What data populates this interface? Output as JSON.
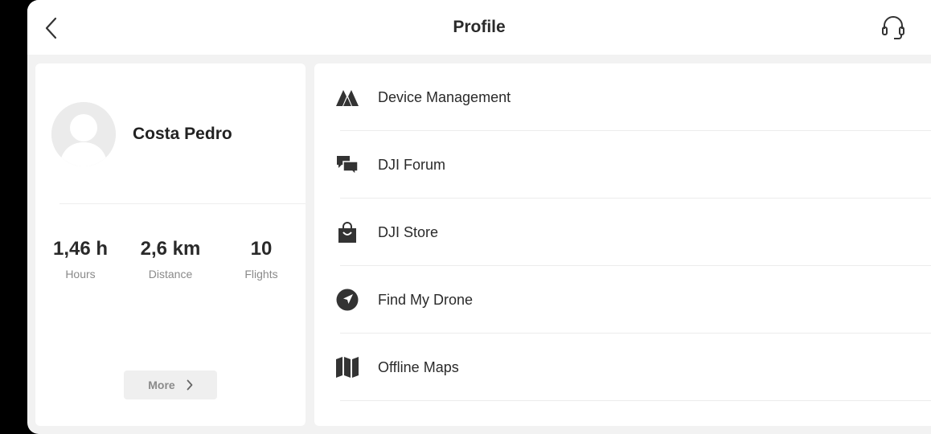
{
  "header": {
    "title": "Profile",
    "back_icon": "chevron-left-icon",
    "support_icon": "headset-icon"
  },
  "profile": {
    "name": "Costa Pedro",
    "stats": [
      {
        "value": "1,46 h",
        "label": "Hours"
      },
      {
        "value": "2,6 km",
        "label": "Distance"
      },
      {
        "value": "10",
        "label": "Flights"
      }
    ],
    "more_label": "More"
  },
  "menu": {
    "items": [
      {
        "label": "Device Management",
        "icon": "drone-brand-icon"
      },
      {
        "label": "DJI Forum",
        "icon": "chat-bubbles-icon"
      },
      {
        "label": "DJI Store",
        "icon": "shopping-bag-icon"
      },
      {
        "label": "Find My Drone",
        "icon": "locate-arrow-icon"
      },
      {
        "label": "Offline Maps",
        "icon": "map-icon"
      }
    ]
  },
  "colors": {
    "background": "#f2f2f2",
    "card": "#ffffff",
    "text": "#2a2a2a",
    "muted": "#8a8a8a",
    "icon": "#333333"
  }
}
